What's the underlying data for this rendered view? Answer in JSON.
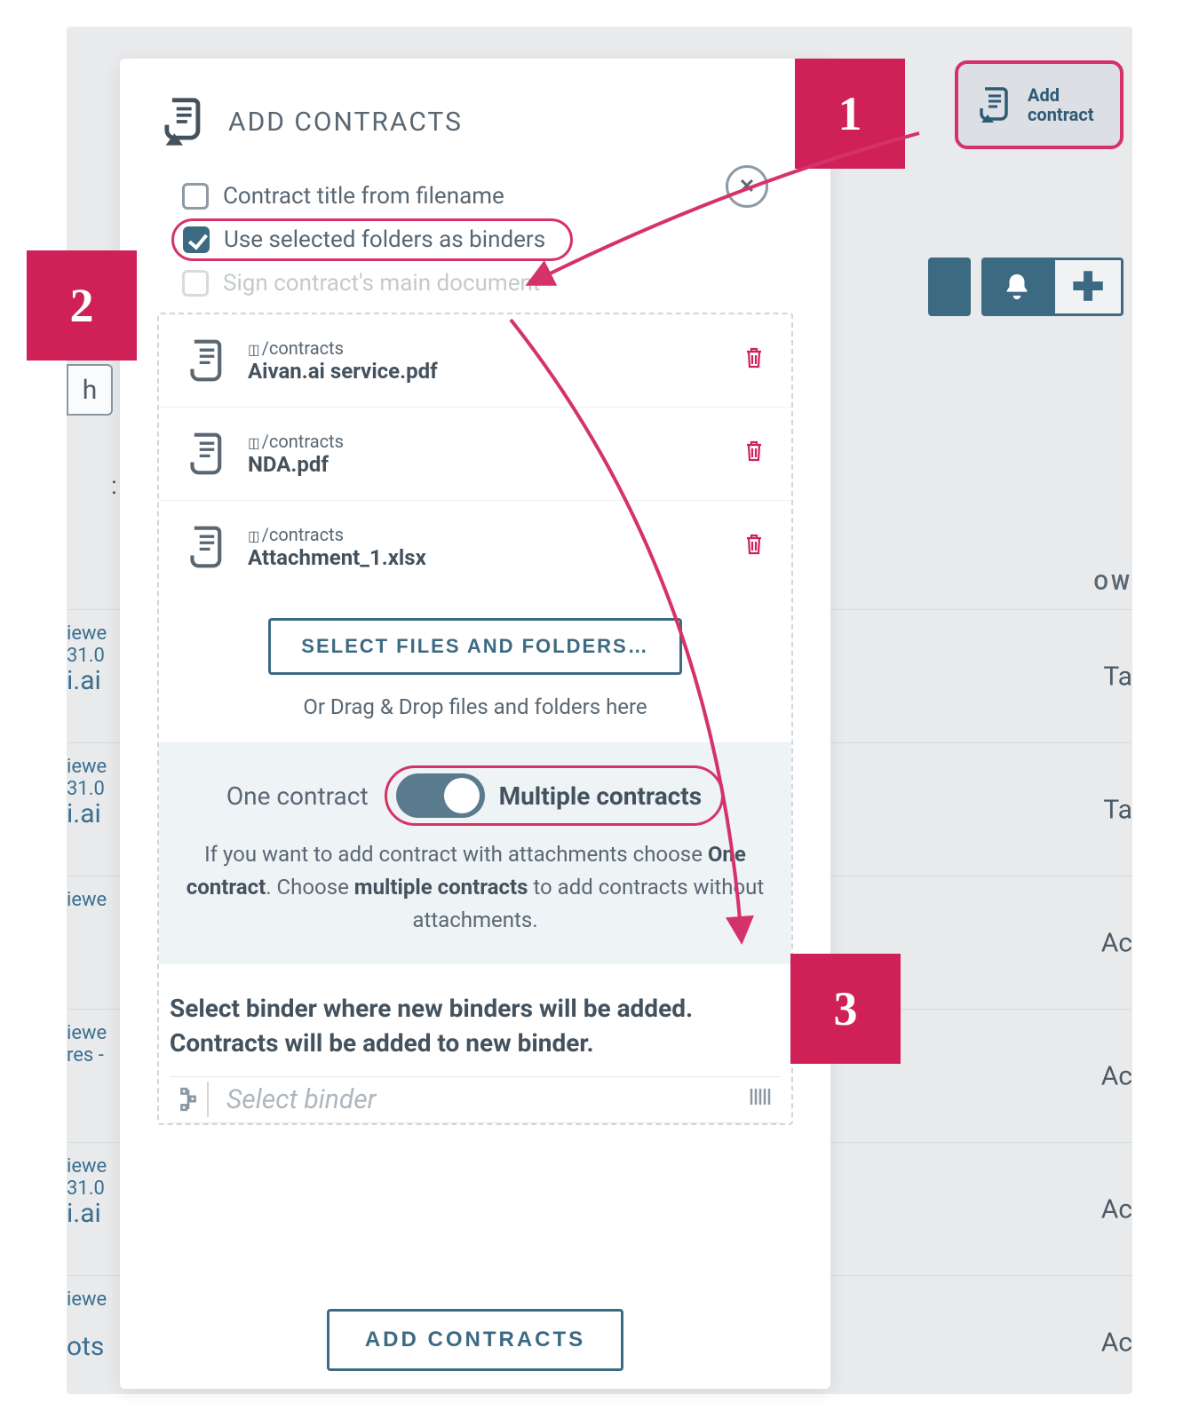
{
  "callouts": {
    "one": "1",
    "two": "2",
    "three": "3"
  },
  "add_contract_btn": {
    "line1": "Add",
    "line2": "contract"
  },
  "modal": {
    "title": "ADD CONTRACTS",
    "checkbox1": "Contract title from filename",
    "checkbox2": "Use selected folders as binders",
    "checkbox3": "Sign contract's main document",
    "files": [
      {
        "path": "/contracts",
        "name": "Aivan.ai service.pdf"
      },
      {
        "path": "/contracts",
        "name": "NDA.pdf"
      },
      {
        "path": "/contracts",
        "name": "Attachment_1.xlsx"
      }
    ],
    "select_files_btn": "SELECT FILES AND FOLDERS…",
    "dragdrop": "Or Drag & Drop files and folders here",
    "toggle": {
      "left": "One contract",
      "right": "Multiple contracts",
      "help_1": "If you want to add contract with attachments choose ",
      "help_b1": "One contract",
      "help_2": ". Choose ",
      "help_b2": "multiple contracts",
      "help_3": " to add contracts without attachments."
    },
    "binder_heading": "Select binder where new binders will be added. Contracts will be added to new binder.",
    "binder_placeholder": "Select binder",
    "add_btn": "ADD CONTRACTS"
  },
  "bg": {
    "search_tail": "h",
    "header_right": "OW",
    "rows": [
      {
        "l1": "iewe",
        "l1b": "31.0",
        "l2": "i.ai",
        "r": "Ta",
        "alt": true
      },
      {
        "l1": "iewe",
        "l1b": "31.0",
        "l2": "i.ai",
        "r": "Ta",
        "alt": false
      },
      {
        "l1": "iewe",
        "l1b": "",
        "l2": "",
        "r": "Ac",
        "alt": false
      },
      {
        "l1": "iewe",
        "l1b": "res -",
        "l2": "",
        "r": "Ac",
        "alt": false
      },
      {
        "l1": "iewe",
        "l1b": "31.0",
        "l2": "i.ai",
        "r": "Ac",
        "alt": false
      },
      {
        "l1": "iewe",
        "l1b": "",
        "l2": "ots",
        "r": "Ac",
        "alt": false
      }
    ]
  }
}
